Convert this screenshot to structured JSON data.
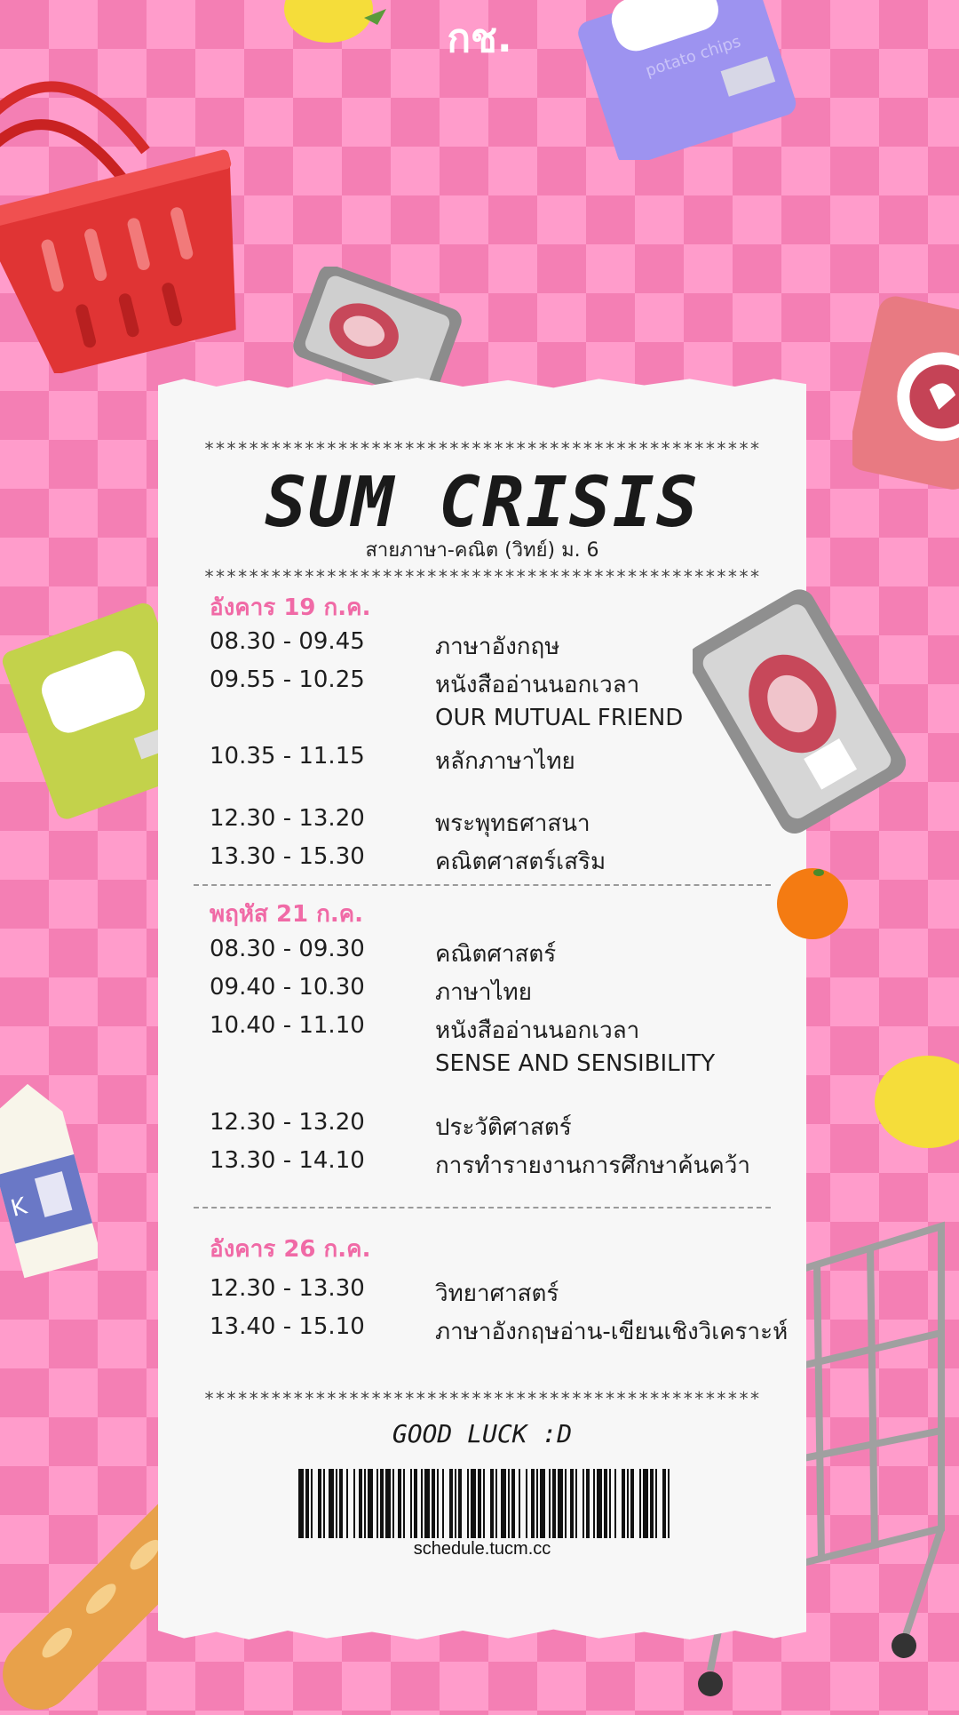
{
  "header": {
    "top_label": "กช."
  },
  "receipt": {
    "stars": "**************************************************",
    "title": "SUM CRISIS",
    "subtitle": "สายภาษา-คณิต  (วิทย์) ม. 6",
    "days": [
      {
        "heading": "อังคาร 19 ก.ค.",
        "rows": [
          {
            "time": "08.30 - 09.45",
            "subject": "ภาษาอังกฤษ"
          },
          {
            "time": "09.55 - 10.25",
            "subject": "หนังสืออ่านนอกเวลา"
          },
          {
            "time": "",
            "subject": "OUR MUTUAL FRIEND"
          },
          {
            "time": "10.35 - 11.15",
            "subject": "หลักภาษาไทย"
          },
          {
            "time": "12.30 - 13.20",
            "subject": "พระพุทธศาสนา"
          },
          {
            "time": "13.30 - 15.30",
            "subject": "คณิตศาสตร์เสริม"
          }
        ]
      },
      {
        "heading": "พฤหัส 21 ก.ค.",
        "rows": [
          {
            "time": "08.30 - 09.30",
            "subject": "คณิตศาสตร์"
          },
          {
            "time": "09.40 - 10.30",
            "subject": "ภาษาไทย"
          },
          {
            "time": "10.40 - 11.10",
            "subject": "หนังสืออ่านนอกเวลา"
          },
          {
            "time": "",
            "subject": "SENSE AND SENSIBILITY"
          },
          {
            "time": "12.30 - 13.20",
            "subject": "ประวัติศาสตร์"
          },
          {
            "time": "13.30 - 14.10",
            "subject": "การทำรายงานการศึกษาค้นคว้า"
          }
        ]
      },
      {
        "heading": "อังคาร 26 ก.ค.",
        "rows": [
          {
            "time": "12.30 - 13.30",
            "subject": "วิทยาศาสตร์"
          },
          {
            "time": "13.40 - 15.10",
            "subject": "ภาษาอังกฤษอ่าน-เขียนเชิงวิเคราะห์"
          }
        ]
      }
    ],
    "footer": {
      "message": "GOOD LUCK :D",
      "barcode_url": "schedule.tucm.cc"
    }
  },
  "decorations": {
    "chips_label": "potato chips",
    "milk_label": "K"
  },
  "colors": {
    "background": "#f47fb4",
    "checker": "#ff9ccb",
    "accent": "#f06aa6",
    "paper": "#f7f7f7"
  }
}
